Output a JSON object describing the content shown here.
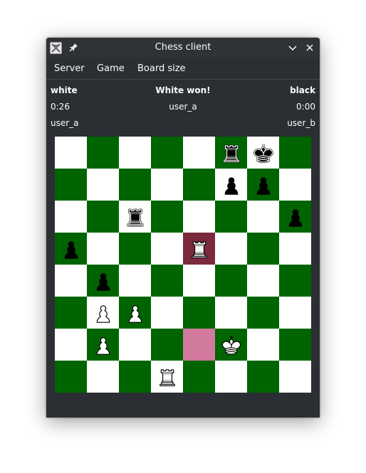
{
  "window": {
    "title": "Chess client"
  },
  "menu": [
    "Server",
    "Game",
    "Board size"
  ],
  "status": {
    "white_label": "white",
    "result": "White won!",
    "black_label": "black",
    "white_time": "0:26",
    "turn_player": "user_a",
    "black_time": "0:00",
    "white_player": "user_a",
    "black_player": "user_b"
  },
  "colors": {
    "light_square": "#ffffff",
    "dark_square": "#006400",
    "last_move_from": "#d17a9e",
    "last_move_to": "#7b2a3e"
  },
  "board": {
    "rows": [
      [
        "",
        "",
        "",
        "",
        "",
        "black-rook",
        "black-king",
        ""
      ],
      [
        "",
        "",
        "",
        "",
        "",
        "black-pawn",
        "black-pawn",
        ""
      ],
      [
        "",
        "",
        "black-rook",
        "",
        "",
        "",
        "",
        "black-pawn"
      ],
      [
        "black-pawn",
        "",
        "",
        "",
        "white-rook",
        "",
        "",
        ""
      ],
      [
        "",
        "black-pawn",
        "",
        "",
        "",
        "",
        "",
        ""
      ],
      [
        "",
        "white-pawn",
        "white-pawn",
        "",
        "",
        "",
        "",
        ""
      ],
      [
        "",
        "white-pawn",
        "",
        "",
        "",
        "white-king",
        "",
        ""
      ],
      [
        "",
        "",
        "",
        "white-rook",
        "",
        "",
        "",
        ""
      ]
    ],
    "highlight_from": {
      "row": 6,
      "col": 4
    },
    "highlight_to": {
      "row": 3,
      "col": 4
    }
  }
}
